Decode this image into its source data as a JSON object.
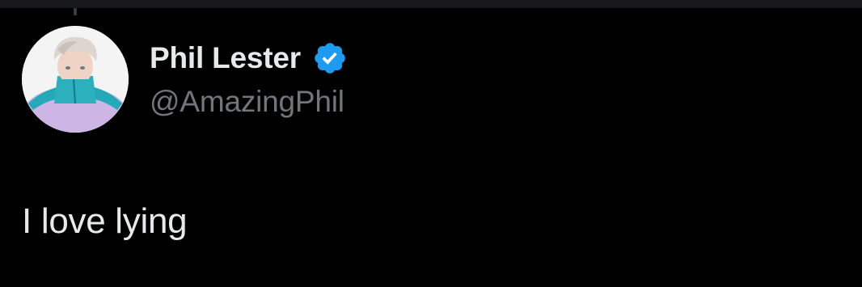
{
  "tweet": {
    "author": {
      "display_name": "Phil Lester",
      "handle": "@AmazingPhil",
      "verified": true,
      "avatar_icon": "profile-photo",
      "verified_icon": "verified-badge-icon"
    },
    "text": "I love lying"
  },
  "colors": {
    "background": "#000000",
    "text_primary": "#e7e9ea",
    "text_secondary": "#71767b",
    "verified_blue": "#1d9bf0"
  }
}
